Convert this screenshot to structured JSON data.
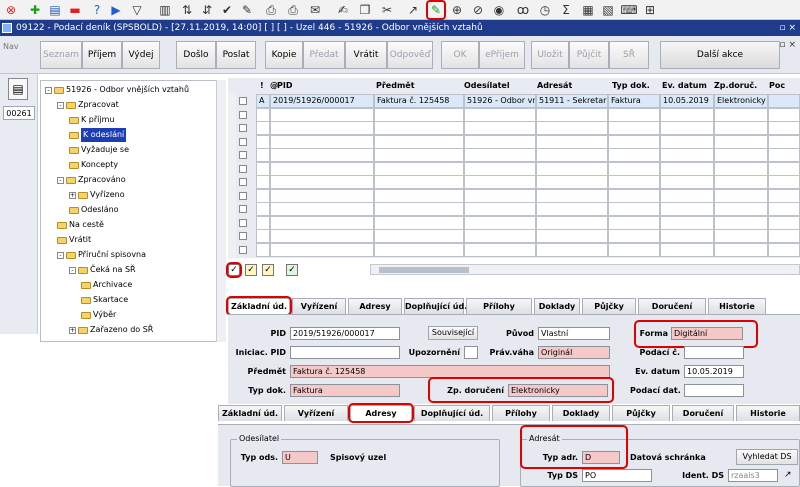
{
  "toolbar": {
    "icons": [
      "close-icon",
      "add-icon",
      "save-icon",
      "delete-icon",
      "help-icon",
      "next-icon",
      "filter-icon",
      "chart-icon",
      "sort-asc-icon",
      "sort-desc-icon",
      "check-icon",
      "tools-icon",
      "print-icon",
      "print-preview-icon",
      "mail-icon",
      "edit-icon",
      "copy-icon",
      "cut-icon",
      "open-external-icon",
      "attach-icon",
      "globe-icon",
      "compass-icon",
      "eye-icon",
      "glasses-icon",
      "clock-icon",
      "sum-icon",
      "excel-icon",
      "pdf-icon",
      "keyboard-icon",
      "tree-icon"
    ]
  },
  "title": {
    "text": "09122 - Podací deník (SPSBOLD) - [27.11.2019, 14:00]  [ ] [ ] - Uzel 446 - 51926 - Odbor vnějších vztahů",
    "window_controls": "▫ ×"
  },
  "actions": {
    "items": [
      {
        "label": "Seznam",
        "enabled": false
      },
      {
        "label": "Příjem",
        "enabled": true
      },
      {
        "label": "Výdej",
        "enabled": true
      },
      {
        "label": "Došlo",
        "enabled": true
      },
      {
        "label": "Poslat",
        "enabled": true
      },
      {
        "label": "Kopie",
        "enabled": true
      },
      {
        "label": "Předat",
        "enabled": false
      },
      {
        "label": "Vrátit",
        "enabled": true
      },
      {
        "label": "Odpověď",
        "enabled": false
      },
      {
        "label": "OK",
        "enabled": false
      },
      {
        "label": "ePříjem",
        "enabled": false
      },
      {
        "label": "Uložit",
        "enabled": false
      },
      {
        "label": "Půjčit",
        "enabled": false
      },
      {
        "label": "SŘ",
        "enabled": false
      }
    ],
    "more_label": "Další akce",
    "window_controls": "▫ ×"
  },
  "sidebar": {
    "nav_label": "Nav",
    "doc_number": "00261"
  },
  "tree": {
    "items": [
      {
        "label": "51926 - Odbor vnějších vztahů",
        "level": 0,
        "toggle": "-"
      },
      {
        "label": "Zpracovat",
        "level": 1,
        "toggle": "-"
      },
      {
        "label": "K příjmu",
        "level": 2,
        "toggle": ""
      },
      {
        "label": "K odeslání",
        "level": 2,
        "toggle": "",
        "selected": true
      },
      {
        "label": "Vyžaduje se",
        "level": 2,
        "toggle": ""
      },
      {
        "label": "Koncepty",
        "level": 2,
        "toggle": ""
      },
      {
        "label": "Zpracováno",
        "level": 1,
        "toggle": "-"
      },
      {
        "label": "Vyřízeno",
        "level": 2,
        "toggle": "+"
      },
      {
        "label": "Odesláno",
        "level": 2,
        "toggle": ""
      },
      {
        "label": "Na cestě",
        "level": 1,
        "toggle": ""
      },
      {
        "label": "Vrátit",
        "level": 1,
        "toggle": ""
      },
      {
        "label": "Příruční spisovna",
        "level": 1,
        "toggle": "-"
      },
      {
        "label": "Čeká na SŘ",
        "level": 2,
        "toggle": "-"
      },
      {
        "label": "Archivace",
        "level": 3,
        "toggle": ""
      },
      {
        "label": "Skartace",
        "level": 3,
        "toggle": ""
      },
      {
        "label": "Výběr",
        "level": 3,
        "toggle": ""
      },
      {
        "label": "Zařazeno do SŘ",
        "level": 2,
        "toggle": "+"
      }
    ]
  },
  "grid": {
    "columns": [
      "!",
      "@",
      "PID",
      "Předmět",
      "Odesílatel",
      "Adresát",
      "Typ dok.",
      "Ev. datum",
      "Zp.doruč.",
      "Poc"
    ],
    "rows": [
      [
        "",
        "A",
        "2019/51926/000017",
        "Faktura č. 125458",
        "51926 - Odbor vně",
        "51911 - Sekretariá",
        "Faktura",
        "10.05.2019",
        "Elektronicky",
        ""
      ]
    ],
    "empty_rows": 11
  },
  "tabs1": {
    "items": [
      "Základní úd.",
      "Vyřízení",
      "Adresy",
      "Doplňující úd.",
      "Přílohy",
      "Doklady",
      "Půjčky",
      "Doručení",
      "Historie"
    ],
    "active": "Základní úd."
  },
  "basic": {
    "pid_label": "PID",
    "pid_value": "2019/51926/000017",
    "related_button": "Související",
    "origin_label": "Původ",
    "origin_value": "Vlastní",
    "form_label": "Forma",
    "form_value": "Digitální",
    "init_pid_label": "Iniciac. PID",
    "init_pid_value": "",
    "notice_label": "Upozornění",
    "legal_label": "Práv.váha",
    "legal_value": "Originál",
    "filing_label": "Podací č.",
    "filing_value": "",
    "subject_label": "Předmět",
    "subject_value": "Faktura č. 125458",
    "ev_date_label": "Ev. datum",
    "ev_date_value": "10.05.2019",
    "doc_type_label": "Typ dok.",
    "doc_type_value": "Faktura",
    "delivery_label": "Zp. doručení",
    "delivery_value": "Elektronicky",
    "filing_date_label": "Podací dat.",
    "filing_date_value": ""
  },
  "tabs2": {
    "items": [
      "Základní úd.",
      "Vyřízení",
      "Adresy",
      "Doplňující úd.",
      "Přílohy",
      "Doklady",
      "Půjčky",
      "Doručení",
      "Historie"
    ],
    "active": "Adresy"
  },
  "addresses": {
    "sender_group": "Odesílatel",
    "sender_type_label": "Typ ods.",
    "sender_type_value": "U",
    "sender_node_label": "Spisový uzel",
    "recipient_group": "Adresát",
    "recipient_type_label": "Typ adr.",
    "recipient_type_value": "D",
    "databox_label": "Datová schránka",
    "find_ds_button": "Vyhledat DS",
    "ds_type_label": "Typ DS",
    "ds_type_value": "PO",
    "ds_ident_label": "Ident. DS",
    "ds_ident_value": "rzaais3"
  }
}
